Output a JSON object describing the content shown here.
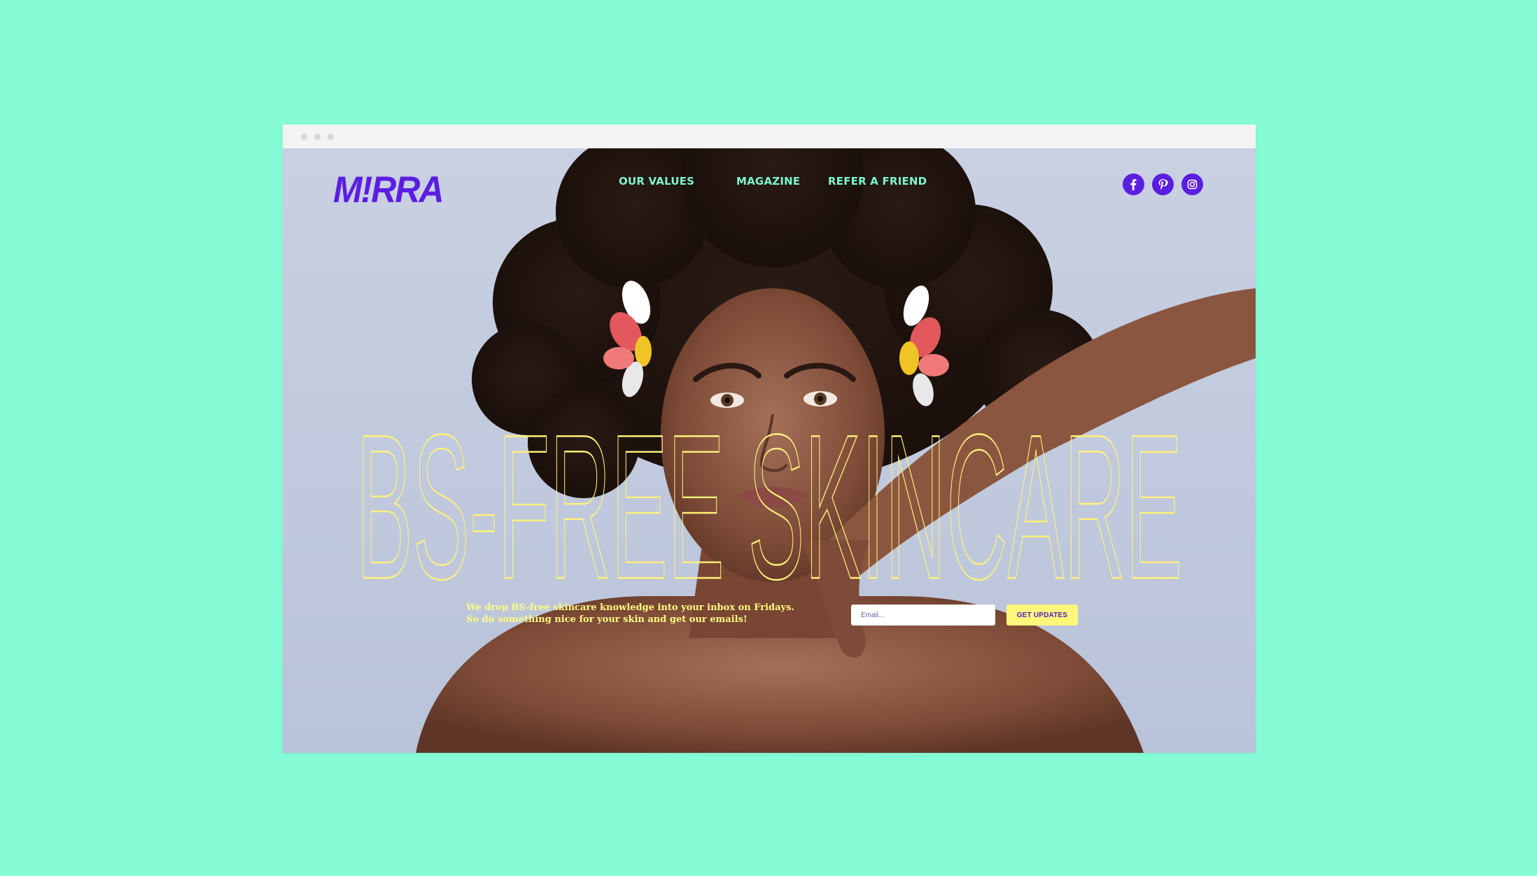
{
  "brand": {
    "logo_text": "M!RRA",
    "color": "#5a1ee0"
  },
  "nav": {
    "items": [
      {
        "label": "OUR VALUES"
      },
      {
        "label": "MAGAZINE"
      },
      {
        "label": "REFER A FRIEND"
      }
    ],
    "color": "#7cf7cf"
  },
  "social": {
    "icons": [
      "facebook-icon",
      "pinterest-icon",
      "instagram-icon"
    ]
  },
  "hero": {
    "headline": "BS-FREE SKINCARE",
    "headline_color": "#fff27a",
    "tagline_line1": "We drop BS-free skincare knowledge into your inbox on Fridays.",
    "tagline_line2": "So do something nice for your skin and get our emails!"
  },
  "signup": {
    "email_placeholder": "Email...",
    "button_label": "GET UPDATES",
    "button_color": "#fdf77a"
  },
  "page": {
    "background": "#85fcd6"
  }
}
